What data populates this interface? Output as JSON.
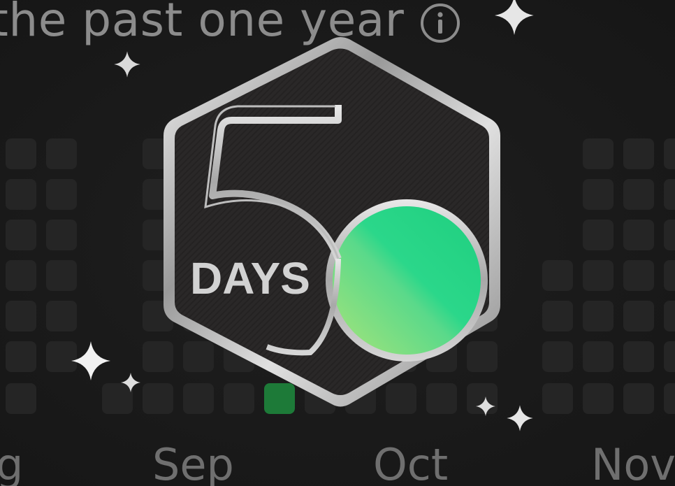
{
  "header": {
    "title": "the past one year",
    "info_icon": "info-circle-icon"
  },
  "months": [
    "Aug",
    "Sep",
    "Oct",
    "Nov"
  ],
  "month_labels_visible": [
    "g",
    "Sep",
    "Oct",
    "Nov"
  ],
  "badge": {
    "number": "50",
    "unit": "DAYS",
    "accent_color": "#2ed47a",
    "metal_color": "#c9c9c9"
  },
  "heatmap": {
    "empty_color": "#252525",
    "active_color": "#1d7a38"
  },
  "decorations": {
    "sparkle_icon": "sparkle-icon"
  }
}
